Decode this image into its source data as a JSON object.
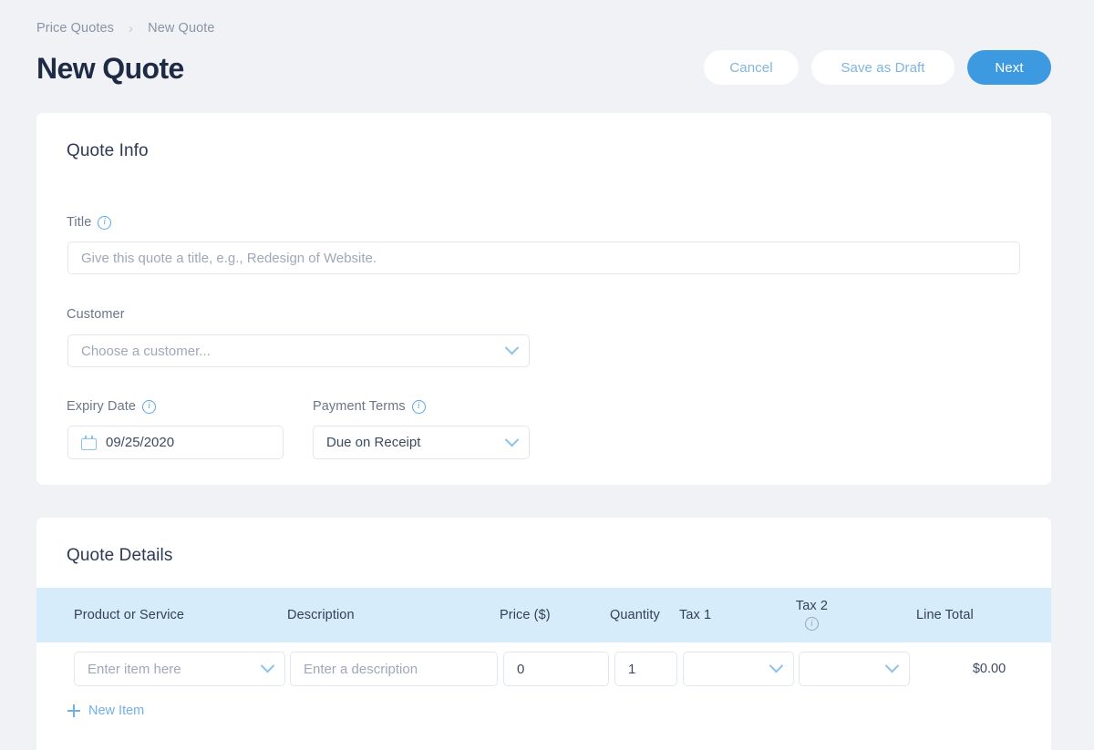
{
  "breadcrumb": {
    "parent": "Price Quotes",
    "separator": "›",
    "current": "New Quote"
  },
  "header": {
    "title": "New Quote",
    "buttons": {
      "cancel": "Cancel",
      "save_draft": "Save as Draft",
      "next": "Next"
    },
    "accent_color": "#3e9ae0"
  },
  "quote_info": {
    "heading": "Quote Info",
    "title_field": {
      "label": "Title",
      "info_icon": "info-circle-icon",
      "placeholder": "Give this quote a title, e.g., Redesign of Website.",
      "value": ""
    },
    "customer_field": {
      "label": "Customer",
      "placeholder": "Choose a customer...",
      "value": ""
    },
    "expiry_field": {
      "label": "Expiry Date",
      "info_icon": "info-circle-icon",
      "calendar_icon": "calendar-icon",
      "value": "09/25/2020"
    },
    "payment_terms_field": {
      "label": "Payment Terms",
      "info_icon": "info-circle-icon",
      "value": "Due on Receipt"
    }
  },
  "quote_details": {
    "heading": "Quote Details",
    "header_bg": "#d7ecfa",
    "columns": [
      {
        "key": "product",
        "label": "Product or Service"
      },
      {
        "key": "description",
        "label": "Description"
      },
      {
        "key": "price",
        "label": "Price ($)"
      },
      {
        "key": "quantity",
        "label": "Quantity"
      },
      {
        "key": "tax1",
        "label": "Tax 1"
      },
      {
        "key": "tax2",
        "label": "Tax 2",
        "info_icon": "info-circle-icon"
      },
      {
        "key": "line_total",
        "label": "Line Total"
      }
    ],
    "rows": [
      {
        "product_placeholder": "Enter item here",
        "product_value": "",
        "description_placeholder": "Enter a description",
        "description_value": "",
        "price_value": "0",
        "quantity_value": "1",
        "tax1_value": "",
        "tax2_value": "",
        "line_total": "$0.00"
      }
    ],
    "new_item_label": "New Item"
  }
}
